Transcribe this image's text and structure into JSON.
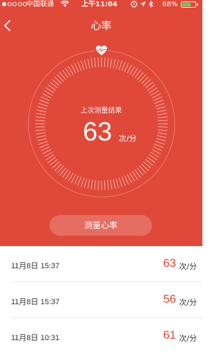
{
  "status_bar": {
    "carrier": "中国联通",
    "time": "上午11:04",
    "battery_percent": "68%",
    "battery_level": 0.68
  },
  "nav": {
    "title": "心率"
  },
  "result": {
    "label": "上次测量结果",
    "value": "63",
    "unit": "次/分"
  },
  "measure_button": "测量心率",
  "history": [
    {
      "time": "11月8日 15:37",
      "value": "63",
      "unit": "次/分"
    },
    {
      "time": "11月8日 15:37",
      "value": "56",
      "unit": "次/分"
    },
    {
      "time": "11月8日 10:31",
      "value": "61",
      "unit": "次/分"
    }
  ],
  "colors": {
    "accent": "#e0493a",
    "battery": "#4cd964"
  }
}
